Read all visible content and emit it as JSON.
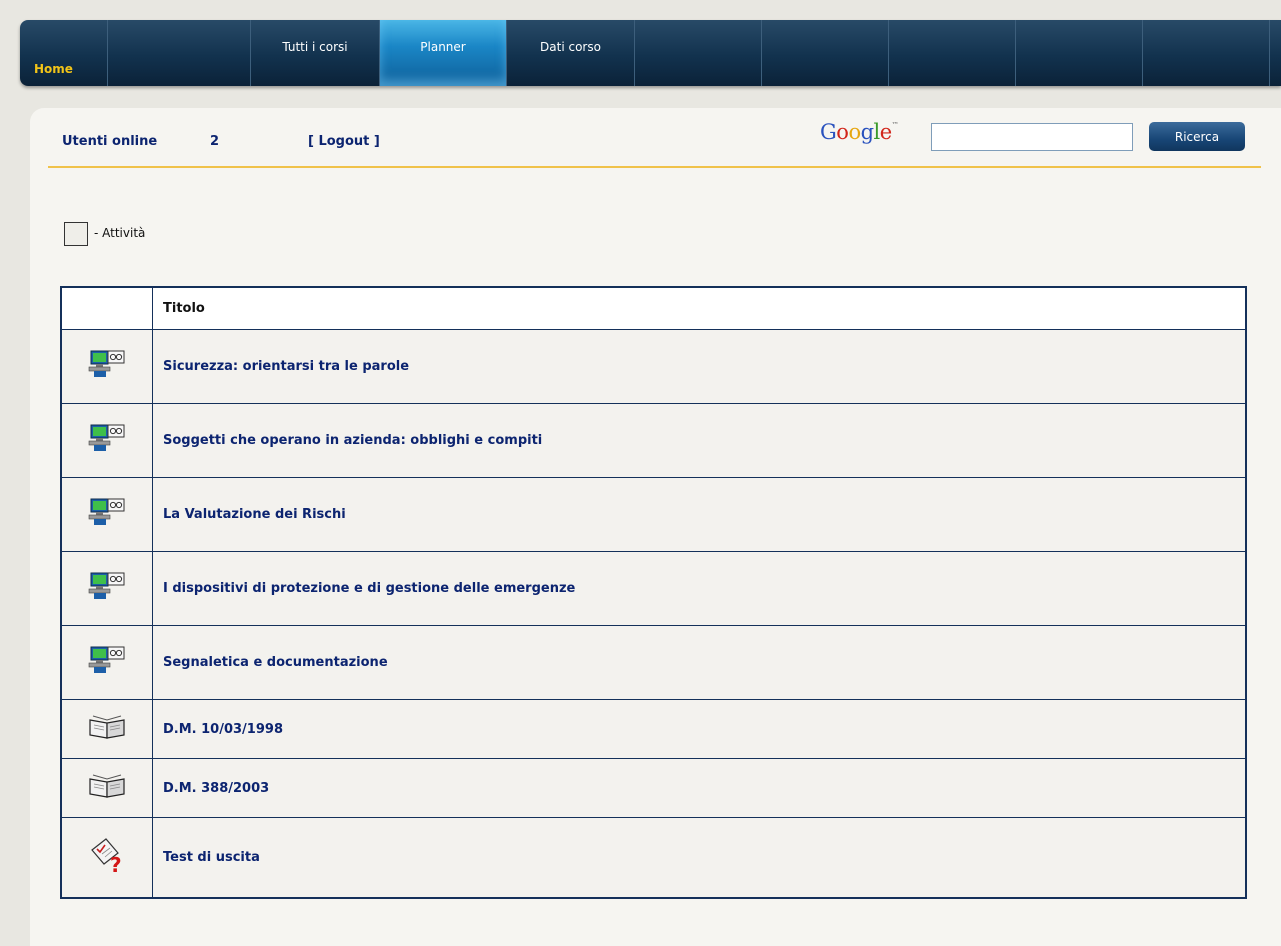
{
  "nav": {
    "home_label": "Home",
    "tabs": [
      {
        "label": "Tutti i corsi",
        "active": false
      },
      {
        "label": "Planner",
        "active": true
      },
      {
        "label": "Dati corso",
        "active": false
      }
    ]
  },
  "status": {
    "online_label": "Utenti online",
    "online_count": "2",
    "logout_label": "[ Logout ]"
  },
  "search": {
    "google_logo": "Google",
    "value": "",
    "button_label": "Ricerca"
  },
  "legend": {
    "text": "- Attività"
  },
  "table": {
    "header_title": "Titolo",
    "rows": [
      {
        "title": "Sicurezza: orientarsi tra le parole",
        "icon": "lesson-computer-icon"
      },
      {
        "title": "Soggetti che operano in azienda: obblighi e compiti",
        "icon": "lesson-computer-icon"
      },
      {
        "title": "La Valutazione dei Rischi",
        "icon": "lesson-computer-icon"
      },
      {
        "title": "I dispositivi di protezione e di gestione delle emergenze",
        "icon": "lesson-computer-icon"
      },
      {
        "title": "Segnaletica e documentazione",
        "icon": "lesson-computer-icon"
      },
      {
        "title": "D.M. 10/03/1998",
        "icon": "open-book-icon"
      },
      {
        "title": "D.M. 388/2003",
        "icon": "open-book-icon"
      },
      {
        "title": "Test di uscita",
        "icon": "quiz-test-icon"
      }
    ]
  },
  "colors": {
    "nav_bg": "#12324e",
    "tab_active": "#1a86c6",
    "home_label": "#f2c418",
    "link_text": "#0c2470",
    "divider": "#f0c24a",
    "table_border": "#14305a"
  }
}
